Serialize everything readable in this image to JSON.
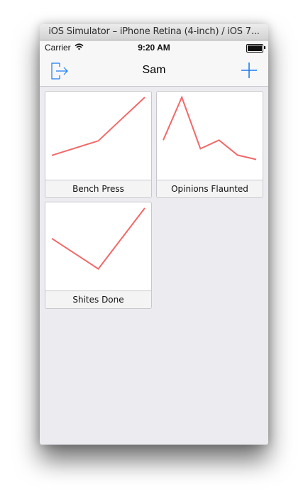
{
  "window": {
    "title": "iOS Simulator – iPhone Retina (4-inch) / iOS 7..."
  },
  "status_bar": {
    "carrier": "Carrier",
    "time": "9:20 AM"
  },
  "nav": {
    "title": "Sam"
  },
  "icons": {
    "logout": "logout-icon",
    "add": "plus-icon",
    "wifi": "wifi-icon",
    "battery": "battery-icon"
  },
  "colors": {
    "accent": "#1a7cf5",
    "line": "#f26969",
    "background": "#ebebf0"
  },
  "cards": [
    {
      "label": "Bench Press",
      "chart_data": {
        "type": "line",
        "x": [
          1,
          2,
          3
        ],
        "y": [
          1,
          2,
          5
        ],
        "ylim": [
          0.5,
          5
        ]
      }
    },
    {
      "label": "Opinions Flaunted",
      "chart_data": {
        "type": "line",
        "x": [
          1,
          2,
          3,
          4,
          5,
          6
        ],
        "y": [
          3,
          7,
          2.2,
          3,
          1.6,
          1.2
        ],
        "ylim": [
          0.9,
          7
        ]
      }
    },
    {
      "label": "Shites Done",
      "chart_data": {
        "type": "line",
        "x": [
          1,
          2,
          3
        ],
        "y": [
          3,
          1,
          5
        ],
        "ylim": [
          0.7,
          5
        ]
      }
    }
  ]
}
